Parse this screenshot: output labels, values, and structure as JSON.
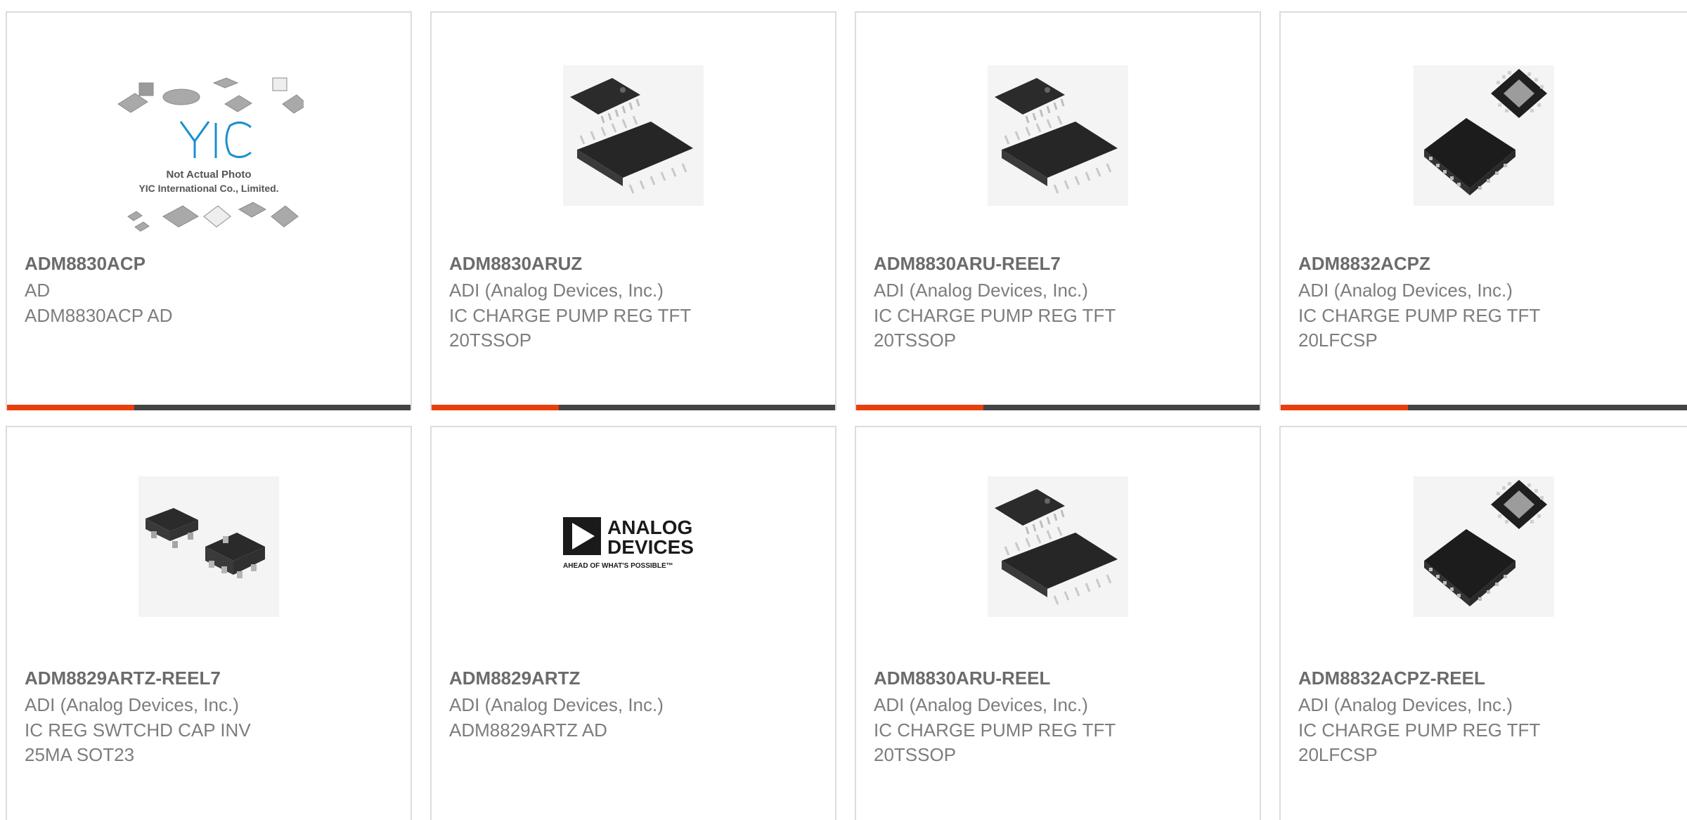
{
  "colors": {
    "accent": "#e8400c",
    "bar": "#444444",
    "border": "#dcdcdc"
  },
  "cards": [
    {
      "part": "ADM8830ACP",
      "lines": [
        "AD",
        "ADM8830ACP AD"
      ],
      "image": "yic-not-actual-photo",
      "placeholder": {
        "caption1": "Not Actual Photo",
        "caption2": "YIC International Co., Limited.",
        "logo": "YIC"
      }
    },
    {
      "part": "ADM8830ARUZ",
      "lines": [
        "ADI (Analog Devices, Inc.)",
        "IC CHARGE PUMP REG TFT",
        "20TSSOP"
      ],
      "image": "tssop-package"
    },
    {
      "part": "ADM8830ARU-REEL7",
      "lines": [
        "ADI (Analog Devices, Inc.)",
        "IC CHARGE PUMP REG TFT",
        "20TSSOP"
      ],
      "image": "tssop-package"
    },
    {
      "part": "ADM8832ACPZ",
      "lines": [
        "ADI (Analog Devices, Inc.)",
        "IC CHARGE PUMP REG TFT",
        "20LFCSP"
      ],
      "image": "lfcsp-package"
    },
    {
      "part": "ADM8829ARTZ-REEL7",
      "lines": [
        "ADI (Analog Devices, Inc.)",
        "IC REG SWTCHD CAP INV",
        "25MA SOT23"
      ],
      "image": "sot23-package"
    },
    {
      "part": "ADM8829ARTZ",
      "lines": [
        "ADI (Analog Devices, Inc.)",
        "ADM8829ARTZ AD"
      ],
      "image": "analog-devices-logo",
      "logo": {
        "line1": "ANALOG",
        "line2": "DEVICES",
        "tagline": "AHEAD OF WHAT'S POSSIBLE™"
      }
    },
    {
      "part": "ADM8830ARU-REEL",
      "lines": [
        "ADI (Analog Devices, Inc.)",
        "IC CHARGE PUMP REG TFT",
        "20TSSOP"
      ],
      "image": "tssop-package"
    },
    {
      "part": "ADM8832ACPZ-REEL",
      "lines": [
        "ADI (Analog Devices, Inc.)",
        "IC CHARGE PUMP REG TFT",
        "20LFCSP"
      ],
      "image": "lfcsp-package"
    }
  ]
}
